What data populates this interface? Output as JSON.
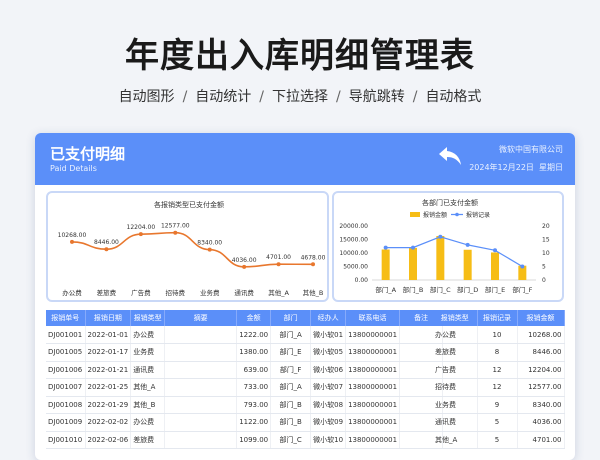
{
  "hero": {
    "title": "年度出入库明细管理表",
    "features": [
      "自动图形",
      "自动统计",
      "下拉选择",
      "导航跳转",
      "自动格式"
    ],
    "separator": "/"
  },
  "header": {
    "title": "已支付明细",
    "subtitle": "Paid Details",
    "company": "微软中国有限公司",
    "date": "2024年12月22日",
    "weekday": "星期日"
  },
  "colors": {
    "accent": "#5b8ff9",
    "bar": "#f6bd16",
    "line_orange": "#e8772e",
    "line_blue": "#5b8ff9"
  },
  "chart_data": [
    {
      "type": "line",
      "title": "各报销类型已支付金额",
      "categories": [
        "办公费",
        "差旅费",
        "广告费",
        "招待费",
        "业务费",
        "通讯费",
        "其他_A",
        "其他_B"
      ],
      "values": [
        10268.0,
        8446.0,
        12204.0,
        12577.0,
        8340.0,
        4036.0,
        4701.0,
        4678.0
      ],
      "labels": [
        "10268.00",
        "8446.00",
        "12204.00",
        "12577.00",
        "8340.00",
        "4036.00",
        "4701.00",
        "4678.00"
      ],
      "ylim": [
        0,
        14000
      ]
    },
    {
      "type": "bar",
      "title": "各部门已支付金额",
      "categories": [
        "部门_A",
        "部门_B",
        "部门_C",
        "部门_D",
        "部门_E",
        "部门_F"
      ],
      "legend": [
        "报销金额",
        "报销记录"
      ],
      "series": [
        {
          "name": "报销金额",
          "type": "bar",
          "axis": "left",
          "values": [
            11300,
            11900,
            16300,
            11200,
            10200,
            5300
          ]
        },
        {
          "name": "报销记录",
          "type": "line",
          "axis": "right",
          "values": [
            12,
            12,
            16,
            13,
            11,
            5
          ]
        }
      ],
      "ylim_left": [
        0,
        20000
      ],
      "ylim_right": [
        0,
        20
      ],
      "yticks_left": [
        "20000.00",
        "15000.00",
        "10000.00",
        "5000.00",
        "0.00"
      ],
      "yticks_right": [
        "20",
        "15",
        "10",
        "5",
        "0"
      ]
    }
  ],
  "table": {
    "headers": [
      "报销单号",
      "报销日期",
      "报销类型",
      "摘要",
      "金额",
      "部门",
      "经办人",
      "联系电话",
      "备注"
    ],
    "rows": [
      [
        "DJ001001",
        "2022-01-01",
        "办公费",
        "",
        "1222.00",
        "部门_A",
        "微小软01",
        "13800000001",
        ""
      ],
      [
        "DJ001005",
        "2022-01-17",
        "业务费",
        "",
        "1380.00",
        "部门_E",
        "微小软05",
        "13800000001",
        ""
      ],
      [
        "DJ001006",
        "2022-01-21",
        "通讯费",
        "",
        "639.00",
        "部门_F",
        "微小软06",
        "13800000001",
        ""
      ],
      [
        "DJ001007",
        "2022-01-25",
        "其他_A",
        "",
        "733.00",
        "部门_A",
        "微小软07",
        "13800000001",
        ""
      ],
      [
        "DJ001008",
        "2022-01-29",
        "其他_B",
        "",
        "793.00",
        "部门_B",
        "微小软08",
        "13800000001",
        ""
      ],
      [
        "DJ001009",
        "2022-02-02",
        "办公费",
        "",
        "1122.00",
        "部门_B",
        "微小软09",
        "13800000001",
        ""
      ],
      [
        "DJ001010",
        "2022-02-06",
        "差旅费",
        "",
        "1099.00",
        "部门_C",
        "微小软10",
        "13800000001",
        ""
      ]
    ]
  },
  "side_table": {
    "headers": [
      "报销类型",
      "报销记录",
      "报销金额"
    ],
    "rows": [
      [
        "办公费",
        "10",
        "10268.00"
      ],
      [
        "差旅费",
        "8",
        "8446.00"
      ],
      [
        "广告费",
        "12",
        "12204.00"
      ],
      [
        "招待费",
        "12",
        "12577.00"
      ],
      [
        "业务费",
        "9",
        "8340.00"
      ],
      [
        "通讯费",
        "5",
        "4036.00"
      ],
      [
        "其他_A",
        "5",
        "4701.00"
      ]
    ]
  }
}
